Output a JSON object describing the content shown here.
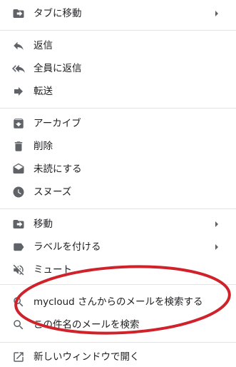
{
  "menu": {
    "items": [
      {
        "label": "タブに移動",
        "icon": "move-to-tab-icon",
        "arrow": true
      },
      {
        "label": "返信",
        "icon": "reply-icon",
        "arrow": false
      },
      {
        "label": "全員に返信",
        "icon": "reply-all-icon",
        "arrow": false
      },
      {
        "label": "転送",
        "icon": "forward-icon",
        "arrow": false
      },
      {
        "label": "アーカイブ",
        "icon": "archive-icon",
        "arrow": false
      },
      {
        "label": "削除",
        "icon": "trash-icon",
        "arrow": false
      },
      {
        "label": "未読にする",
        "icon": "mark-unread-icon",
        "arrow": false
      },
      {
        "label": "スヌーズ",
        "icon": "snooze-clock-icon",
        "arrow": false
      },
      {
        "label": "移動",
        "icon": "move-folder-icon",
        "arrow": true
      },
      {
        "label": "ラベルを付ける",
        "icon": "label-icon",
        "arrow": true
      },
      {
        "label": "ミュート",
        "icon": "mute-icon",
        "arrow": false
      },
      {
        "label": "mycloud さんからのメールを検索する",
        "icon": "search-icon",
        "arrow": false
      },
      {
        "label": "この件名のメールを検索",
        "icon": "search-icon",
        "arrow": false
      },
      {
        "label": "新しいウィンドウで開く",
        "icon": "open-in-new-window-icon",
        "arrow": false
      }
    ]
  },
  "annotation": {
    "color": "#d0222a"
  },
  "colors": {
    "icon": "#5f6368",
    "text": "#202124",
    "divider": "#e3e3e3"
  }
}
